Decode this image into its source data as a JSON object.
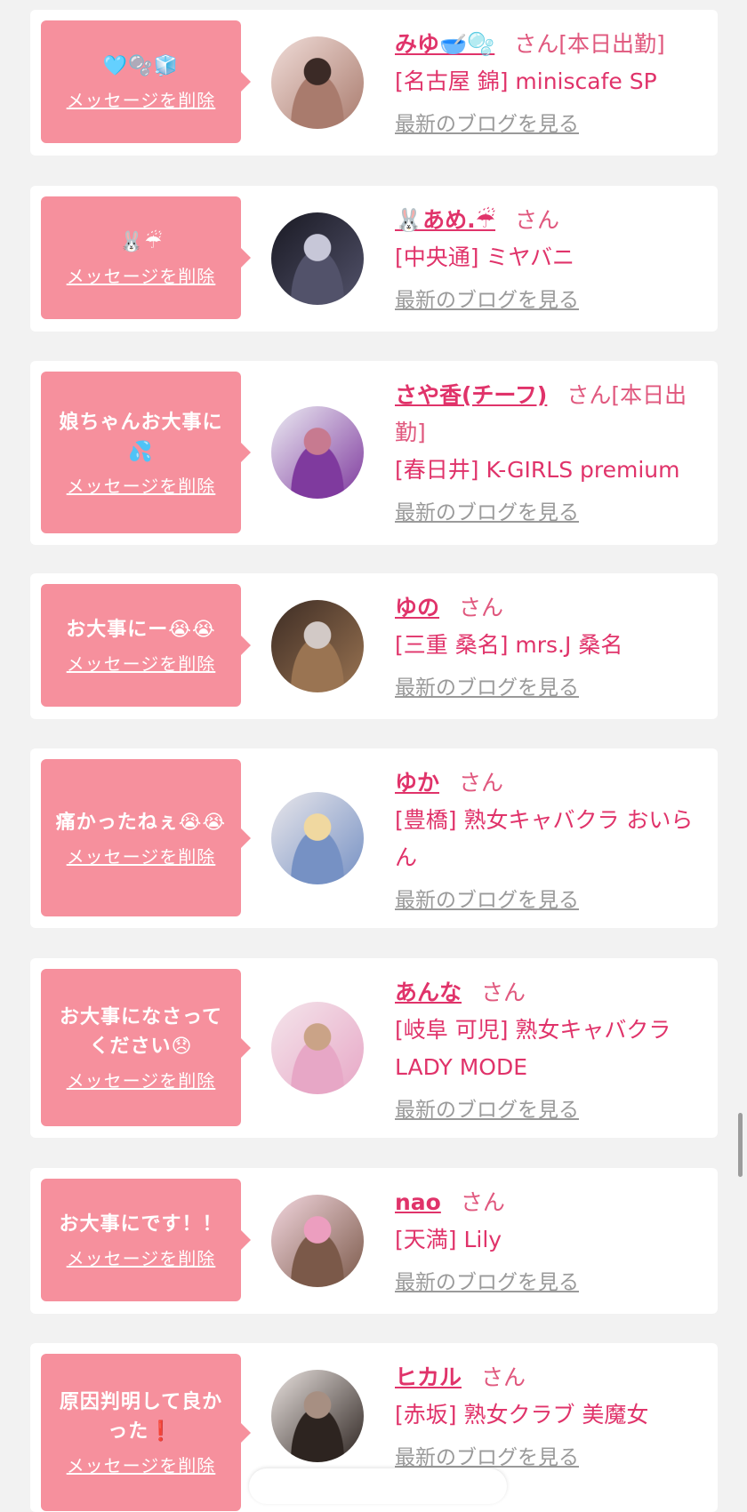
{
  "delete_label": "メッセージを削除",
  "san_label": "さん",
  "blog_label": "最新のブログを見る",
  "colors": {
    "background": "#f2f2f2",
    "bubble": "#f6909d",
    "name": "#e0336a",
    "blog_link": "#9a9a9a"
  },
  "items": [
    {
      "message": "🩵🫧🧊",
      "name": "みゆ🥣🫧",
      "suffix": "[本日出勤]",
      "shop": "[名古屋 錦] miniscafe SP",
      "avatar_colors": [
        "#f0dcd8",
        "#a97b6d",
        "#3b2a26"
      ]
    },
    {
      "message": "🐰☔",
      "name": "🐰あめ.☔",
      "suffix": "",
      "shop": "[中央通] ミヤバニ",
      "avatar_colors": [
        "#191923",
        "#52526a",
        "#c7c7d8"
      ]
    },
    {
      "message": "娘ちゃんお大事に💦",
      "name": "さや香(チーフ)",
      "suffix": "[本日出勤]",
      "shop": "[春日井] K-GIRLS premium",
      "avatar_colors": [
        "#ececf3",
        "#7f3a9e",
        "#c77a90"
      ]
    },
    {
      "message": "お大事にー😭😭",
      "name": "ゆの",
      "suffix": "",
      "shop": "[三重 桑名] mrs.J 桑名",
      "avatar_colors": [
        "#3d2c24",
        "#9a7452",
        "#d2c9c6"
      ]
    },
    {
      "message": "痛かったねぇ😭😭",
      "name": "ゆか",
      "suffix": "",
      "shop": "[豊橋] 熟女キャバクラ おいらん",
      "avatar_colors": [
        "#e8e6ea",
        "#7691c4",
        "#f0d8a0"
      ]
    },
    {
      "message": "お大事になさってください😞",
      "name": "あんな",
      "suffix": "",
      "shop": "[岐阜 可児] 熟女キャバクラ LADY MODE",
      "avatar_colors": [
        "#f4e5eb",
        "#e7a7c6",
        "#caa387"
      ]
    },
    {
      "message": "お大事にです！！",
      "name": "nao",
      "suffix": "",
      "shop": "[天満] Lily",
      "avatar_colors": [
        "#f2d6de",
        "#7b5949",
        "#ec9ebf"
      ]
    },
    {
      "message": "原因判明して良かった❗",
      "name": "ヒカル",
      "suffix": "",
      "shop": "[赤坂] 熟女クラブ 美魔女",
      "avatar_colors": [
        "#e9e2df",
        "#2d2420",
        "#a78f82"
      ]
    }
  ]
}
